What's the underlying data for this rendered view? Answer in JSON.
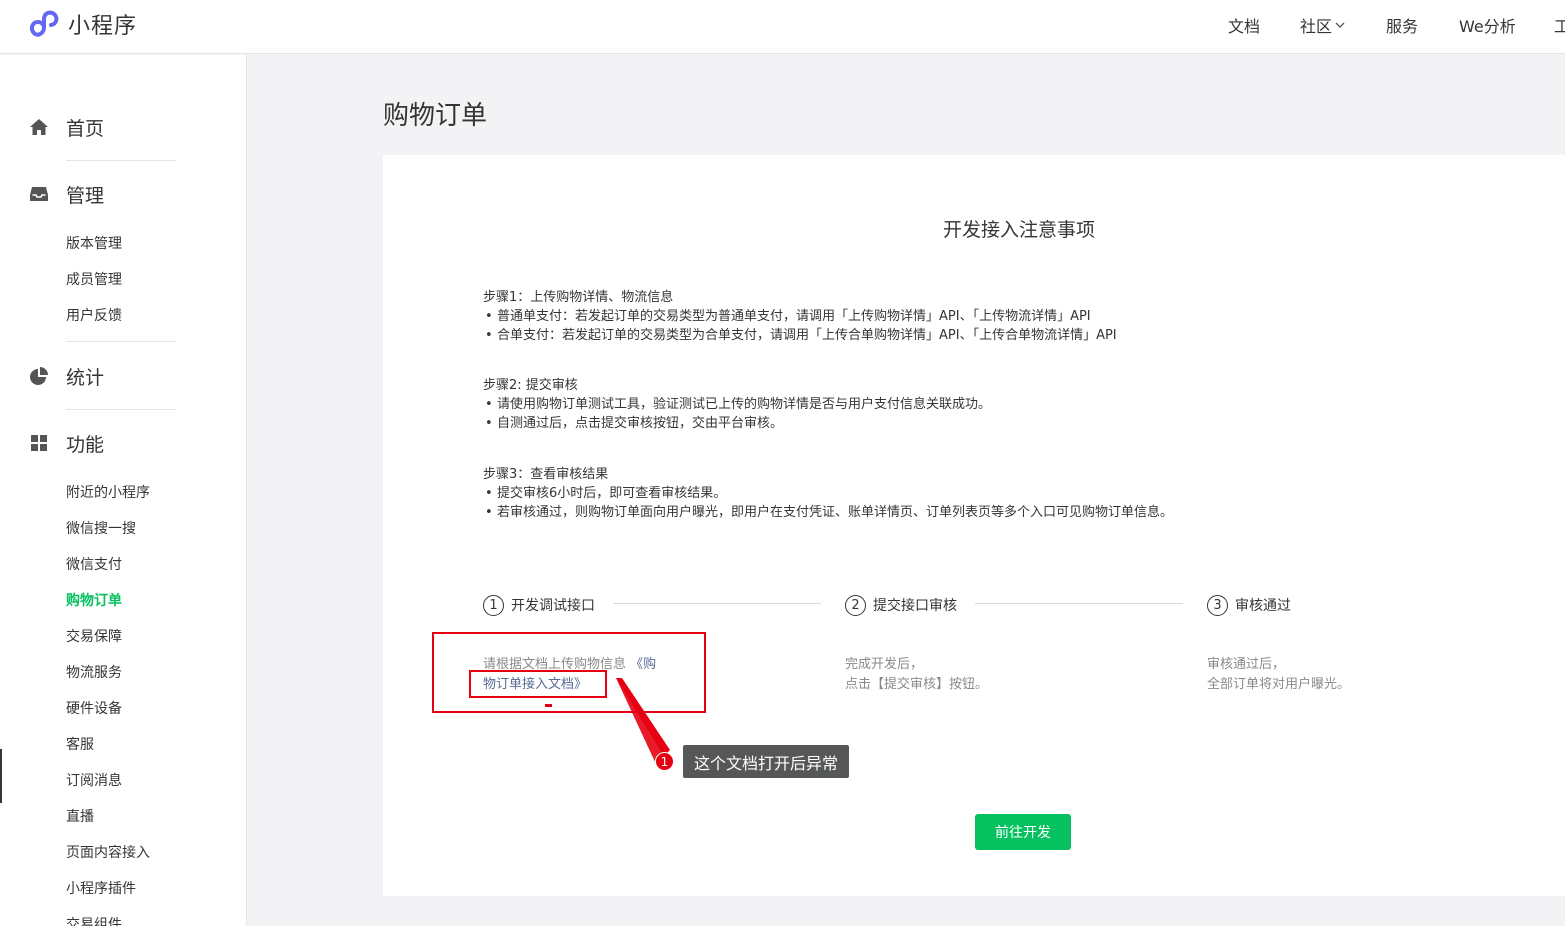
{
  "header": {
    "logo_text": "小程序",
    "nav": [
      {
        "label": "文档"
      },
      {
        "label": "社区"
      },
      {
        "label": "服务"
      },
      {
        "label": "We分析"
      },
      {
        "label": "工"
      }
    ]
  },
  "sidebar": {
    "sections": [
      {
        "label": "首页",
        "icon": "home-icon"
      },
      {
        "label": "管理",
        "icon": "inbox-icon",
        "items": [
          "版本管理",
          "成员管理",
          "用户反馈"
        ]
      },
      {
        "label": "统计",
        "icon": "pie-chart-icon"
      },
      {
        "label": "功能",
        "icon": "grid-icon",
        "items": [
          "附近的小程序",
          "微信搜一搜",
          "微信支付",
          "购物订单",
          "交易保障",
          "物流服务",
          "硬件设备",
          "客服",
          "订阅消息",
          "直播",
          "页面内容接入",
          "小程序插件",
          "交易组件"
        ]
      }
    ],
    "active_item": "购物订单"
  },
  "main": {
    "page_title": "购物订单",
    "notice_title": "开发接入注意事项",
    "steps": [
      {
        "title": "步骤1：上传购物详情、物流信息",
        "bullets": [
          "普通单支付：若发起订单的交易类型为普通单支付，请调用「上传购物详情」API、「上传物流详情」API",
          "合单支付：若发起订单的交易类型为合单支付，请调用「上传合单购物详情」API、「上传合单物流详情」API"
        ]
      },
      {
        "title": "步骤2: 提交审核",
        "bullets": [
          "请使用购物订单测试工具，验证测试已上传的购物详情是否与用户支付信息关联成功。",
          "自测通过后，点击提交审核按钮，交由平台审核。"
        ]
      },
      {
        "title": "步骤3：查看审核结果",
        "bullets": [
          "提交审核6小时后，即可查看审核结果。",
          "若审核通过，则购物订单面向用户曝光，即用户在支付凭证、账单详情页、订单列表页等多个入口可见购物订单信息。"
        ]
      }
    ],
    "flow": [
      {
        "num": "1",
        "label": "开发调试接口",
        "desc_line1": "请根据文档上传购物信息 ",
        "link1": "《购",
        "link2": "物订单接入文档》"
      },
      {
        "num": "2",
        "label": "提交接口审核",
        "desc_line1": "完成开发后，",
        "desc_line2": "点击【提交审核】按钮。"
      },
      {
        "num": "3",
        "label": "审核通过",
        "desc_line1": "审核通过后，",
        "desc_line2": "全部订单将对用户曝光。"
      }
    ],
    "go_button": "前往开发"
  },
  "annotation": {
    "badge": "1",
    "tooltip": "这个文档打开后异常",
    "color": "#e60012"
  },
  "colors": {
    "accent": "#07c160",
    "link": "#576b95",
    "text": "#353535"
  }
}
